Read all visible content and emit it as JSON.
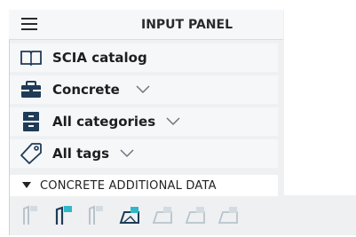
{
  "panel": {
    "title": "INPUT PANEL"
  },
  "rows": {
    "catalog": "SCIA catalog",
    "material": "Concrete",
    "categories": "All categories",
    "tags": "All tags"
  },
  "section": {
    "label": "CONCRETE ADDITIONAL DATA"
  },
  "colors": {
    "accent": "#2fb8c9",
    "icon_dark": "#1f3b57",
    "disabled": "#b9c3cc"
  },
  "toolbar_icons": [
    "member-data-icon-disabled",
    "member-data-icon",
    "member-data-icon-disabled",
    "surface-data-icon",
    "surface-data-icon-disabled",
    "surface-data-icon-disabled",
    "surface-data-icon-disabled"
  ]
}
